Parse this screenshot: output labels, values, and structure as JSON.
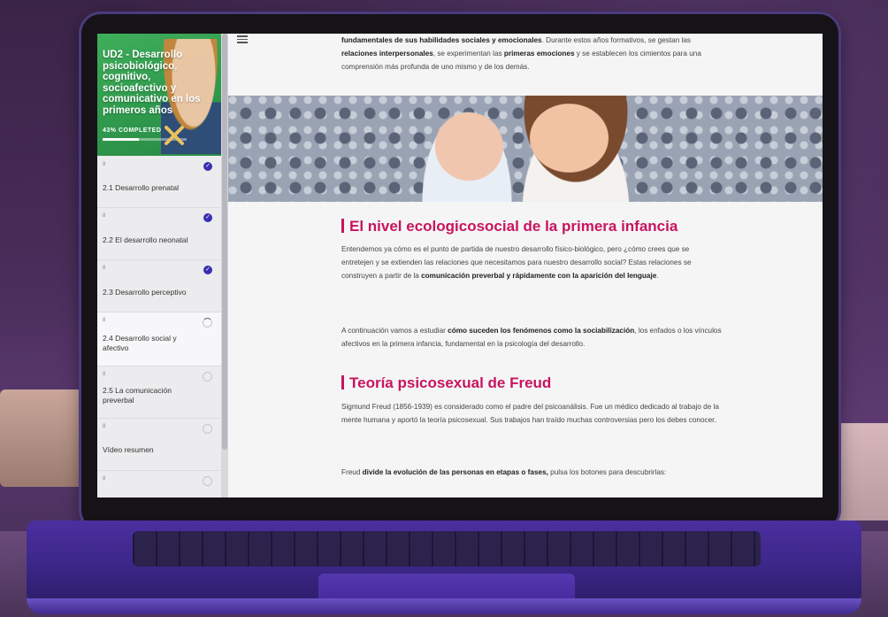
{
  "course": {
    "title": "UD2 - Desarrollo psicobiológico, cognitivo, socioafectivo y comunicativo en los primeros años",
    "progress_label": "43% COMPLETED",
    "progress_fraction": 0.43
  },
  "sidebar": {
    "items": [
      {
        "num": "8",
        "label": "2.1 Desarrollo prenatal",
        "status": "complete"
      },
      {
        "num": "8",
        "label": "2.2 El desarrollo neonatal",
        "status": "complete"
      },
      {
        "num": "8",
        "label": "2.3 Desarrollo perceptivo",
        "status": "complete"
      },
      {
        "num": "8",
        "label": "2.4 Desarrollo social y afectivo",
        "status": "in-progress"
      },
      {
        "num": "8",
        "label": "2.5 La comunicación preverbal",
        "status": "incomplete"
      },
      {
        "num": "8",
        "label": "Vídeo resumen",
        "status": "incomplete"
      },
      {
        "num": "8",
        "label": "",
        "status": "incomplete"
      }
    ]
  },
  "main": {
    "intro": {
      "t1": "fundamentales de sus habilidades sociales y emocionales",
      "t2": ". Durante estos años formativos, se gestan las ",
      "t3": "relaciones interpersonales",
      "t4": ", se experimentan las ",
      "t5": "primeras emociones",
      "t6": " y se establecen los cimientos para una comprensión más profunda de uno mismo y de los demás."
    },
    "section1": {
      "heading": "El nivel ecologicosocial de la primera infancia",
      "p1": {
        "t1": "Entendemos ya cómo es el punto de partida de nuestro desarrollo físico-biológico, pero ¿cómo crees que se entretejen y se extienden las relaciones que necesitamos para nuestro desarrollo social? Estas relaciones se construyen a partir de la ",
        "t2": "comunicación preverbal y rápidamente con la aparición del lenguaje",
        "t3": "."
      },
      "p2": {
        "t1": "A continuación vamos a estudiar ",
        "t2": "cómo suceden los fenómenos como la sociabilización",
        "t3": ", los enfados o los vínculos afectivos en la primera infancia, fundamental en la psicología del desarrollo."
      }
    },
    "section2": {
      "heading": "Teoría psicosexual de Freud",
      "p1": "Sigmund Freud (1856-1939) es considerado como el padre del psicoanálisis. Fue un médico dedicado al trabajo de la mente humana y aportó la teoría psicosexual. Sus trabajos han traído muchas controversias pero los debes conocer.",
      "p2": {
        "t1": "Freud ",
        "t2": "divide la evolución de las personas en etapas o fases,",
        "t3": " pulsa los botones para descubrirlas:"
      }
    }
  },
  "colors": {
    "accent_heading": "#c8145f",
    "course_card": "#3fae5b",
    "check": "#3a2fb0",
    "laptop": "#4b2fa0"
  },
  "icons": [
    "menu-icon",
    "check-icon",
    "circle-icon",
    "cross-icon"
  ]
}
